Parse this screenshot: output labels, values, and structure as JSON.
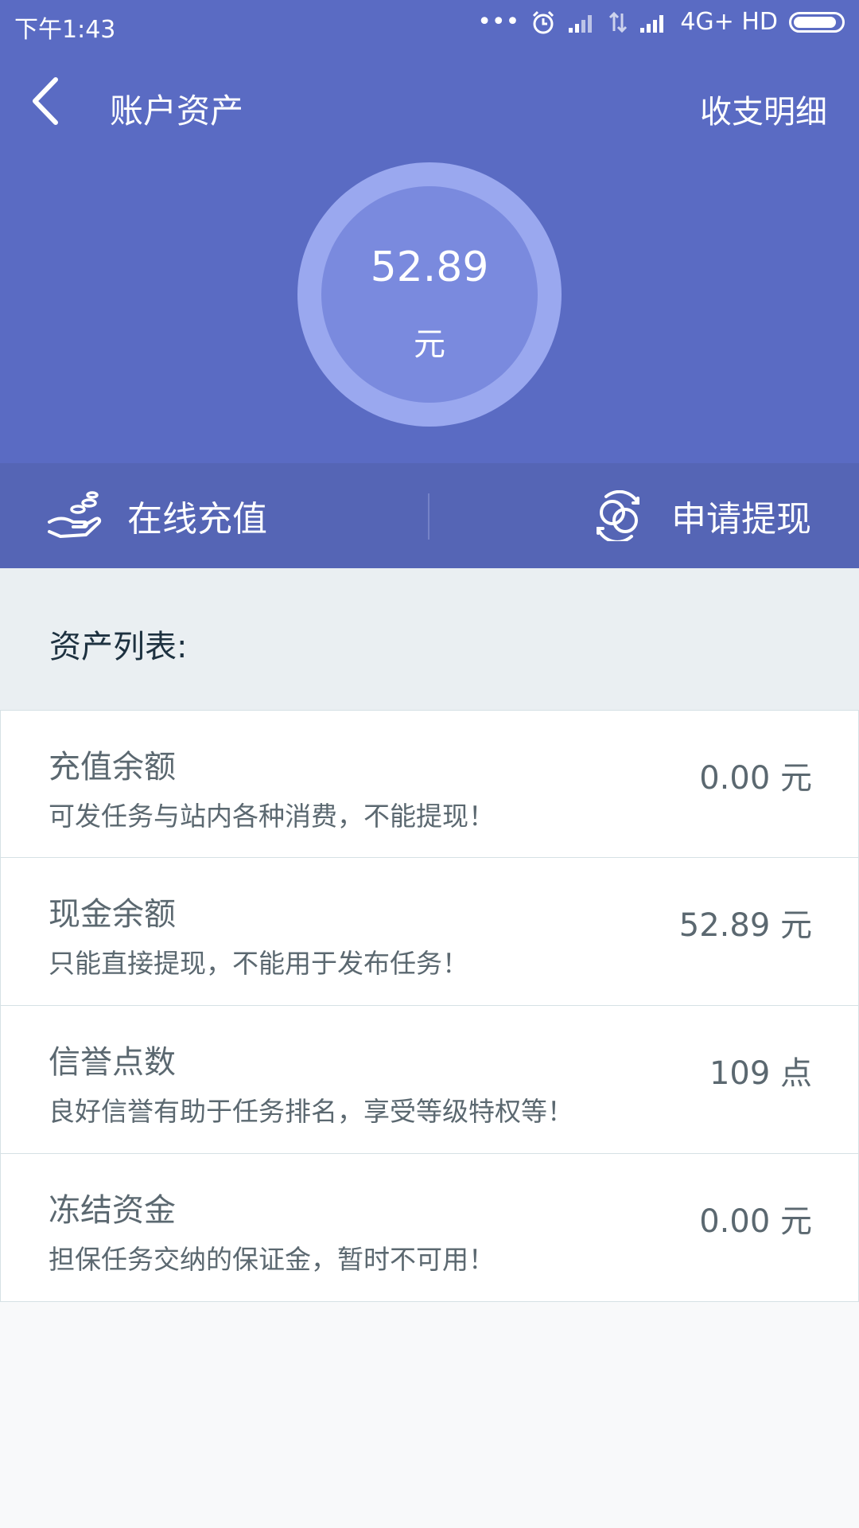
{
  "status_bar": {
    "time": "下午1:43",
    "network": "4G+ HD"
  },
  "header": {
    "title": "账户资产",
    "detail_link": "收支明细"
  },
  "balance": {
    "amount": "52.89",
    "unit": "元"
  },
  "actions": {
    "recharge": "在线充值",
    "withdraw": "申请提现"
  },
  "asset_list": {
    "title": "资产列表:",
    "items": [
      {
        "label": "充值余额",
        "description": "可发任务与站内各种消费，不能提现！",
        "value": "0.00 元"
      },
      {
        "label": "现金余额",
        "description": "只能直接提现，不能用于发布任务！",
        "value": "52.89 元"
      },
      {
        "label": "信誉点数",
        "description": "良好信誉有助于任务排名，享受等级特权等！",
        "value": "109 点"
      },
      {
        "label": "冻结资金",
        "description": "担保任务交纳的保证金，暂时不可用！",
        "value": "0.00 元"
      }
    ]
  },
  "colors": {
    "header_bg": "#5a6bc3",
    "action_bar_bg": "#5565b5",
    "ring_outer": "#9aa8ef",
    "ring_inner": "#7a8ade"
  },
  "icons": [
    "back-arrow-icon",
    "alarm-icon",
    "signal-icon",
    "battery-icon",
    "coins-hand-icon",
    "exchange-icon"
  ]
}
